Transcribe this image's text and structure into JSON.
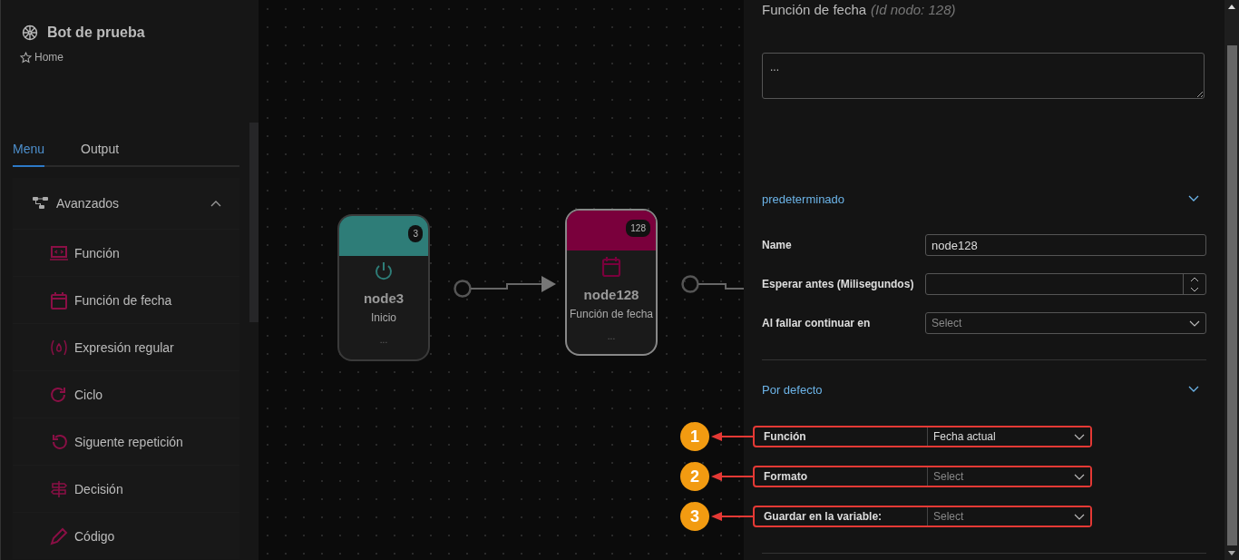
{
  "sidebar": {
    "title": "Bot de prueba",
    "breadcrumb": "Home",
    "tabs": [
      {
        "label": "Menu",
        "selected": true
      },
      {
        "label": "Output",
        "selected": false
      }
    ],
    "group": {
      "label": "Avanzados",
      "expanded": true,
      "items": [
        {
          "label": "Función"
        },
        {
          "label": "Función de fecha"
        },
        {
          "label": "Expresión regular"
        },
        {
          "label": "Ciclo"
        },
        {
          "label": "Siguente repetición"
        },
        {
          "label": "Decisión"
        },
        {
          "label": "Código"
        }
      ]
    }
  },
  "canvas": {
    "nodes": [
      {
        "name": "node3",
        "type": "Inicio",
        "badge": "3",
        "description": "...",
        "color": "#2e7d78",
        "selected": false
      },
      {
        "name": "node128",
        "type": "Función de fecha",
        "badge": "128",
        "description": "...",
        "color": "#7a003c",
        "selected": true
      }
    ]
  },
  "panel": {
    "title": "Función de fecha",
    "node_id": "(Id nodo: 128)",
    "note": "...",
    "sections": [
      {
        "title": "predeterminado",
        "expanded": true,
        "fields": [
          {
            "kind": "text",
            "label": "Name",
            "value": "node128"
          },
          {
            "kind": "number",
            "label": "Esperar antes (Milisegundos)"
          },
          {
            "kind": "select",
            "label": "Al fallar continuar en",
            "placeholder": "Select"
          }
        ]
      },
      {
        "title": "Por defecto",
        "expanded": true,
        "fields": [
          {
            "kind": "select",
            "label": "Función",
            "value": "Fecha actual",
            "callout": "1"
          },
          {
            "kind": "select",
            "label": "Formato",
            "placeholder": "Select",
            "callout": "2"
          },
          {
            "kind": "select",
            "label": "Guardar en la variable:",
            "placeholder": "Select",
            "callout": "3"
          }
        ]
      }
    ]
  }
}
